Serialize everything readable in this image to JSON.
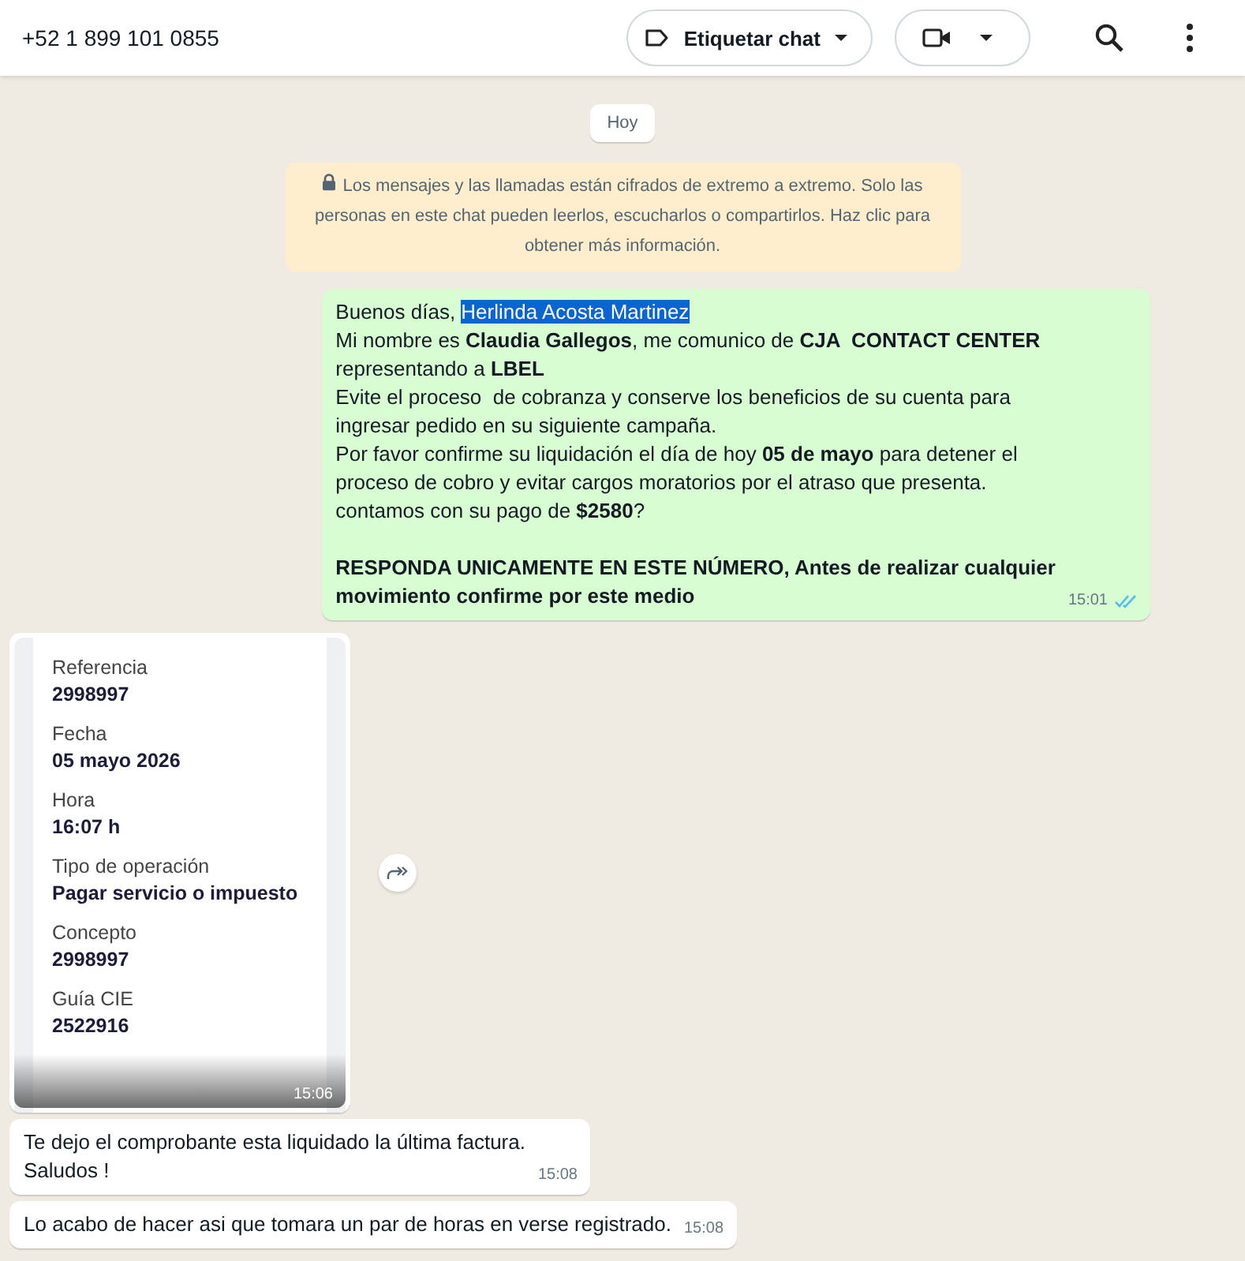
{
  "header": {
    "contact": "+52 1 899 101 0855",
    "label_button": "Etiquetar chat"
  },
  "date_chip": "Hoy",
  "encryption_notice": "Los mensajes y las llamadas están cifrados de extremo a extremo. Solo las personas en este chat pueden leerlos, escucharlos o compartirlos. Haz clic para obtener más información.",
  "messages": [
    {
      "kind": "text",
      "outgoing": true,
      "greeting": "Buenos días, ",
      "highlighted": "Herlinda Acosta Martinez",
      "text": "Mi nombre es **Claudia Gallegos**, me comunico de **CJA  CONTACT CENTER**\nrepresentando a **LBEL**\nEvite el proceso  de cobranza y conserve los beneficios de su cuenta para\ningresar pedido en su siguiente campaña.\nPor favor confirme su liquidación el día de hoy **05 de mayo** para detener el\nproceso de cobro y evitar cargos moratorios por el atraso que presenta.\ncontamos con su pago de **$2580**?\n\n**RESPONDA UNICAMENTE EN ESTE NÚMERO, Antes de realizar cualquier**\n**movimiento confirme por este medio**",
      "time": "15:01",
      "read": true
    },
    {
      "kind": "image",
      "outgoing": false,
      "receipt": [
        {
          "label": "Referencia",
          "value": "2998997"
        },
        {
          "label": "Fecha",
          "value": "05 mayo 2026"
        },
        {
          "label": "Hora",
          "value": "16:07 h"
        },
        {
          "label": "Tipo de operación",
          "value": "Pagar servicio o impuesto"
        },
        {
          "label": "Concepto",
          "value": "2998997"
        },
        {
          "label": "Guía CIE",
          "value": "2522916"
        }
      ],
      "time": "15:06"
    },
    {
      "kind": "text",
      "outgoing": false,
      "text": "Te dejo el comprobante esta liquidado la última factura.\nSaludos !",
      "time": "15:08"
    },
    {
      "kind": "text",
      "outgoing": false,
      "text": "Lo acabo de hacer asi que tomara un par de horas en verse registrado.",
      "time": "15:08"
    }
  ]
}
